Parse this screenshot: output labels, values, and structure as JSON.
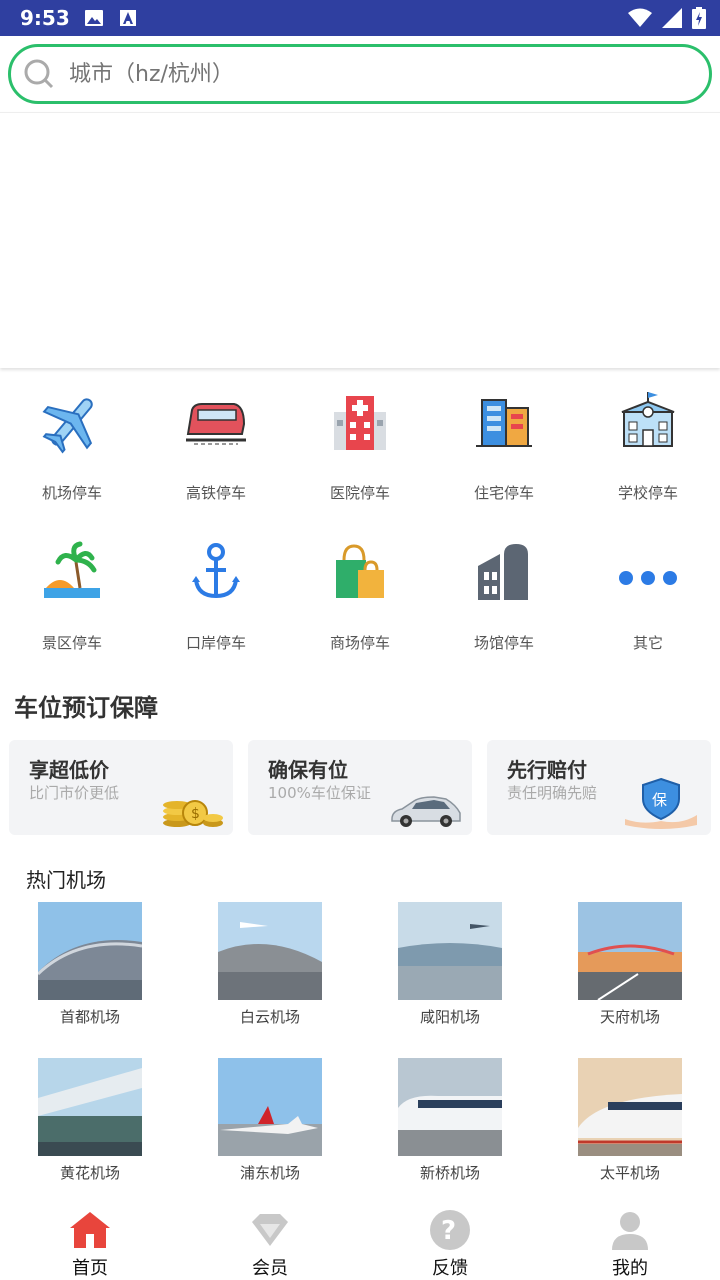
{
  "status_bar": {
    "time": "9:53"
  },
  "search": {
    "placeholder": "城市（hz/杭州）"
  },
  "categories": [
    {
      "label": "机场停车",
      "icon": "airplane-icon"
    },
    {
      "label": "高铁停车",
      "icon": "train-icon"
    },
    {
      "label": "医院停车",
      "icon": "hospital-icon"
    },
    {
      "label": "住宅停车",
      "icon": "residence-icon"
    },
    {
      "label": "学校停车",
      "icon": "school-icon"
    },
    {
      "label": "景区停车",
      "icon": "scenic-icon"
    },
    {
      "label": "口岸停车",
      "icon": "anchor-icon"
    },
    {
      "label": "商场停车",
      "icon": "shopping-bag-icon"
    },
    {
      "label": "场馆停车",
      "icon": "venue-icon"
    },
    {
      "label": "其它",
      "icon": "more-dots-icon"
    }
  ],
  "guarantee": {
    "title": "车位预订保障",
    "cards": [
      {
        "title": "享超低价",
        "subtitle": "比门市价更低",
        "icon": "coins-icon"
      },
      {
        "title": "确保有位",
        "subtitle": "100%车位保证",
        "icon": "car-icon"
      },
      {
        "title": "先行赔付",
        "subtitle": "责任明确先赔",
        "icon": "shield-hand-icon"
      }
    ]
  },
  "hot_airports": {
    "title": "热门机场",
    "items": [
      {
        "name": "首都机场"
      },
      {
        "name": "白云机场"
      },
      {
        "name": "咸阳机场"
      },
      {
        "name": "天府机场"
      },
      {
        "name": "黄花机场"
      },
      {
        "name": "浦东机场"
      },
      {
        "name": "新桥机场"
      },
      {
        "name": "太平机场"
      }
    ]
  },
  "tabbar": {
    "items": [
      {
        "label": "首页",
        "icon": "home-icon",
        "active": true
      },
      {
        "label": "会员",
        "icon": "diamond-icon",
        "active": false
      },
      {
        "label": "反馈",
        "icon": "question-icon",
        "active": false
      },
      {
        "label": "我的",
        "icon": "user-icon",
        "active": false
      }
    ]
  },
  "colors": {
    "status_bar": "#2f3fa0",
    "search_border": "#2bbf6b",
    "tab_active": "#e8453c"
  }
}
